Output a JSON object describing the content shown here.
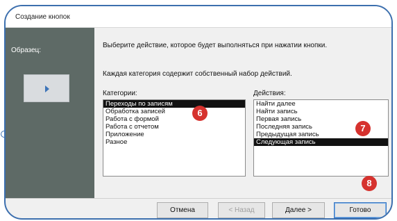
{
  "window": {
    "title": "Создание кнопок"
  },
  "sample": {
    "label": "Образец:"
  },
  "instructions": {
    "line1": "Выберите действие, которое будет выполняться при нажатии кнопки.",
    "line2": "Каждая категория содержит собственный набор действий."
  },
  "categories": {
    "label": "Категории:",
    "items": [
      "Переходы по записям",
      "Обработка записей",
      "Работа с формой",
      "Работа с отчетом",
      "Приложение",
      "Разное"
    ]
  },
  "actions": {
    "label": "Действия:",
    "items": [
      "Найти далее",
      "Найти запись",
      "Первая запись",
      "Последняя запись",
      "Предыдущая запись",
      "Следующая запись"
    ]
  },
  "buttons": {
    "cancel": "Отмена",
    "back": "< Назад",
    "next": "Далее >",
    "finish": "Готово"
  },
  "badges": [
    "6",
    "7",
    "8"
  ],
  "colors": {
    "badge": "#d6322e",
    "frame": "#3c6fae",
    "selection": "#111111",
    "left_panel": "#5e6a66"
  }
}
